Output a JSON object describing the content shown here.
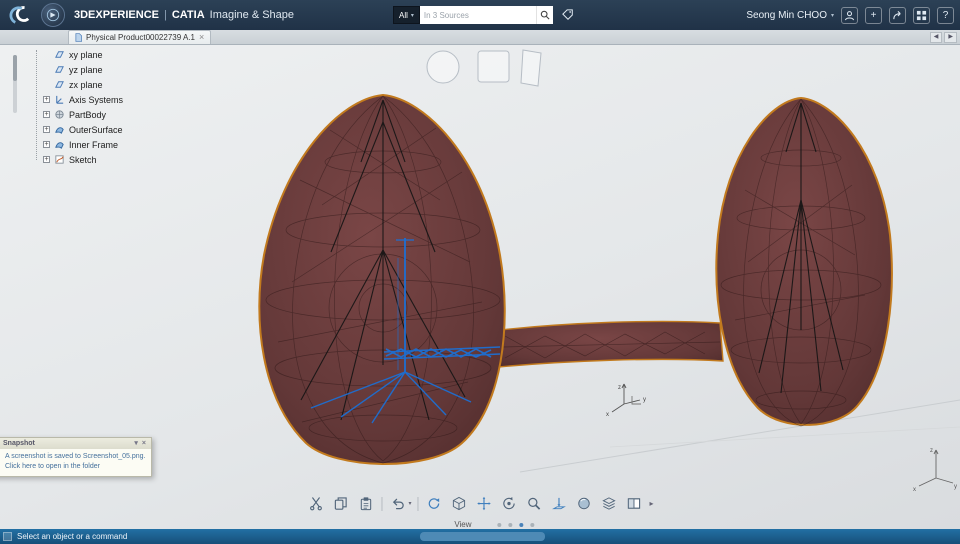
{
  "app": {
    "brand": "3DEXPERIENCE",
    "divider": "|",
    "product": "CATIA",
    "workbench": "Imagine & Shape",
    "user": "Seong Min CHOO"
  },
  "search": {
    "scope": "All",
    "placeholder": "In 3 Sources"
  },
  "tabs": {
    "active": "Physical Product00022739 A.1"
  },
  "tree": {
    "items": [
      {
        "label": "xy plane",
        "icon": "plane-icon"
      },
      {
        "label": "yz plane",
        "icon": "plane-icon"
      },
      {
        "label": "zx plane",
        "icon": "plane-icon"
      },
      {
        "label": "Axis Systems",
        "icon": "axis-system-icon"
      },
      {
        "label": "PartBody",
        "icon": "part-body-icon"
      },
      {
        "label": "OuterSurface",
        "icon": "surface-icon"
      },
      {
        "label": "Inner Frame",
        "icon": "surface-icon"
      },
      {
        "label": "Sketch",
        "icon": "sketch-icon"
      }
    ]
  },
  "viewport": {
    "widgets": [
      "sphere",
      "cube",
      "plane"
    ],
    "axis_labels": {
      "z": "z",
      "x": "x",
      "y": "y"
    }
  },
  "notification": {
    "title": "Snapshot",
    "message": "A screenshot is saved to Screenshot_05.png. Click here to open in the folder"
  },
  "toolbar": {
    "icons": [
      "cut",
      "copy",
      "paste",
      "undo",
      "update",
      "isometric-view",
      "pan",
      "rotate",
      "zoom",
      "normal-to",
      "shaded-view",
      "multi-view",
      "split-view",
      "more"
    ],
    "view_label": "View"
  },
  "statusbar": {
    "message": "Select an object or a command"
  },
  "icons": {
    "chevron_down": "▾",
    "close": "×",
    "left_arrow": "◀",
    "right_arrow": "▶",
    "plus": "+",
    "question": "?",
    "more_arrow": "▸",
    "expand_plus": "+"
  },
  "colors": {
    "topbar": "#22344a",
    "accent_orange": "#c27a1e",
    "model_fill": "#633838",
    "wire_blue": "#1d6fd2",
    "status_blue": "#174f79"
  }
}
